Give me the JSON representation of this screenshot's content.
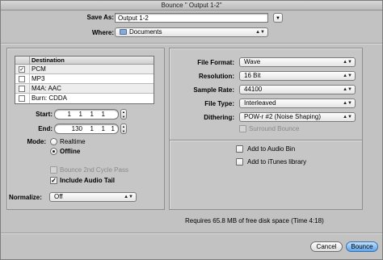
{
  "window": {
    "title": "Bounce \" Output 1-2\""
  },
  "save_as": {
    "label": "Save As:",
    "value": "Output 1-2",
    "expand_icon": "triangle-down-icon"
  },
  "where": {
    "label": "Where:",
    "value": "Documents",
    "folder_icon": "folder-icon"
  },
  "destination": {
    "header": "Destination",
    "rows": [
      {
        "label": "PCM",
        "checked": "✓"
      },
      {
        "label": "MP3",
        "checked": ""
      },
      {
        "label": "M4A: AAC",
        "checked": ""
      },
      {
        "label": "Burn: CDDA",
        "checked": ""
      }
    ]
  },
  "start": {
    "label": "Start:",
    "values": [
      "1",
      "1",
      "1",
      "1"
    ]
  },
  "end": {
    "label": "End:",
    "values": [
      "130",
      "1",
      "1",
      "1"
    ]
  },
  "mode": {
    "label": "Mode:",
    "options": [
      {
        "label": "Realtime"
      },
      {
        "label": "Offline"
      }
    ]
  },
  "bounce_2nd_cycle": {
    "label": "Bounce 2nd Cycle Pass",
    "checked": ""
  },
  "include_audio_tail": {
    "label": "Include Audio Tail",
    "checked": "✓"
  },
  "normalize": {
    "label": "Normalize:",
    "value": "Off"
  },
  "format": {
    "file_format": {
      "label": "File Format:",
      "value": "Wave"
    },
    "resolution": {
      "label": "Resolution:",
      "value": "16 Bit"
    },
    "sample_rate": {
      "label": "Sample Rate:",
      "value": "44100"
    },
    "file_type": {
      "label": "File Type:",
      "value": "Interleaved"
    },
    "dithering": {
      "label": "Dithering:",
      "value": "POW-r #2 (Noise Shaping)"
    },
    "surround_bounce": {
      "label": "Surround Bounce",
      "checked": ""
    }
  },
  "add_to_audio_bin": {
    "label": "Add to Audio Bin",
    "checked": ""
  },
  "add_to_itunes": {
    "label": "Add to iTunes library",
    "checked": ""
  },
  "disk_info": "Requires 65.8 MB of free disk space  (Time 4:18)",
  "buttons": {
    "cancel": "Cancel",
    "bounce": "Bounce"
  }
}
